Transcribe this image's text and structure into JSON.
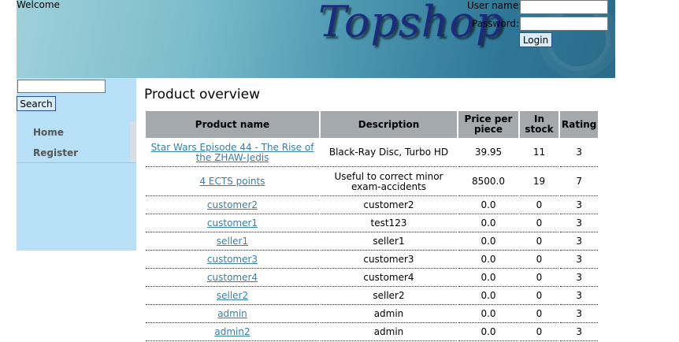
{
  "header": {
    "welcome": "Welcome",
    "logo": "Topshop",
    "username_label": "User name:",
    "password_label": "Password:",
    "username_value": "",
    "password_value": "",
    "login_label": "Login"
  },
  "sidebar": {
    "search_value": "",
    "search_label": "Search",
    "nav": [
      {
        "label": "Home"
      },
      {
        "label": "Register"
      }
    ]
  },
  "main": {
    "title": "Product overview",
    "columns": [
      "Product name",
      "Description",
      "Price per piece",
      "In stock",
      "Rating"
    ],
    "rows": [
      {
        "name": "Star Wars Episode 44 - The Rise of the ZHAW-Jedis",
        "description": "Black-Ray Disc, Turbo HD",
        "price": "39.95",
        "stock": "11",
        "rating": "3"
      },
      {
        "name": "4 ECTS points",
        "description": "Useful to correct minor exam-accidents",
        "price": "8500.0",
        "stock": "19",
        "rating": "7"
      },
      {
        "name": "customer2",
        "description": "customer2",
        "price": "0.0",
        "stock": "0",
        "rating": "3"
      },
      {
        "name": "customer1",
        "description": "test123",
        "price": "0.0",
        "stock": "0",
        "rating": "3"
      },
      {
        "name": "seller1",
        "description": "seller1",
        "price": "0.0",
        "stock": "0",
        "rating": "3"
      },
      {
        "name": "customer3",
        "description": "customer3",
        "price": "0.0",
        "stock": "0",
        "rating": "3"
      },
      {
        "name": "customer4",
        "description": "customer4",
        "price": "0.0",
        "stock": "0",
        "rating": "3"
      },
      {
        "name": "seller2",
        "description": "seller2",
        "price": "0.0",
        "stock": "0",
        "rating": "3"
      },
      {
        "name": "admin",
        "description": "admin",
        "price": "0.0",
        "stock": "0",
        "rating": "3"
      },
      {
        "name": "admin2",
        "description": "admin",
        "price": "0.0",
        "stock": "0",
        "rating": "3"
      }
    ]
  }
}
